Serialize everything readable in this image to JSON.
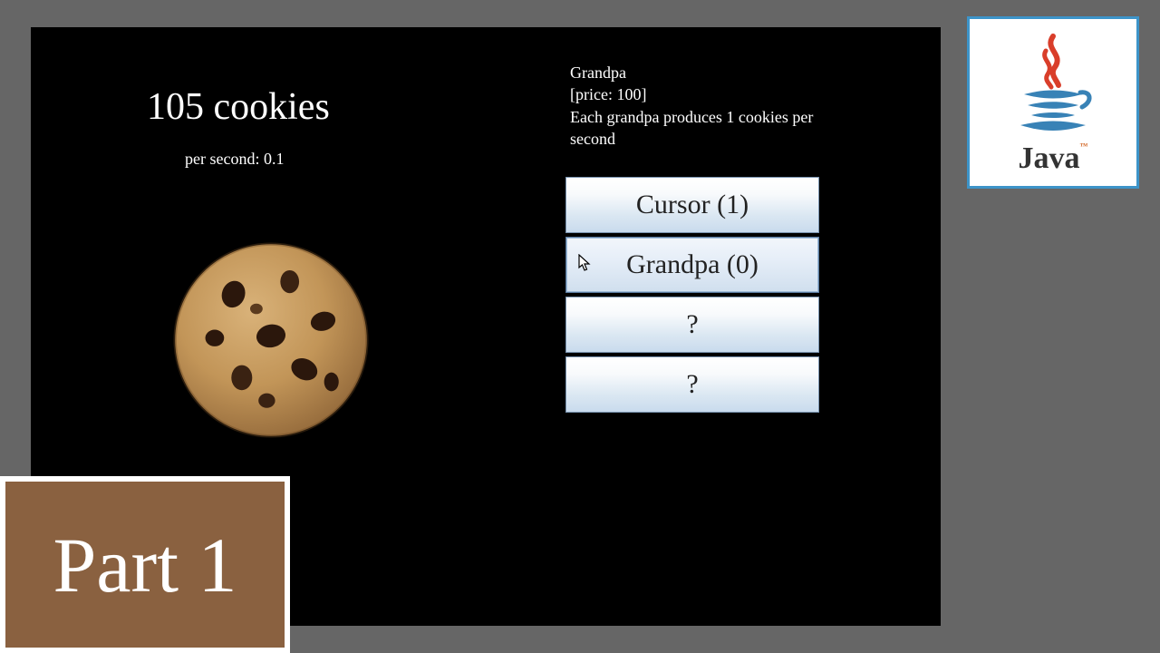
{
  "game": {
    "cookie_count_label": "105 cookies",
    "per_second_label": "per second: 0.1"
  },
  "tooltip": {
    "name": "Grandpa",
    "price_line": "[price: 100]",
    "description": "Each grandpa produces 1 cookies per second"
  },
  "store": {
    "items": [
      {
        "label": "Cursor (1)"
      },
      {
        "label": "Grandpa (0)"
      },
      {
        "label": "?"
      },
      {
        "label": "?"
      }
    ]
  },
  "overlay": {
    "part_label": "Part 1",
    "java_label": "Java"
  }
}
